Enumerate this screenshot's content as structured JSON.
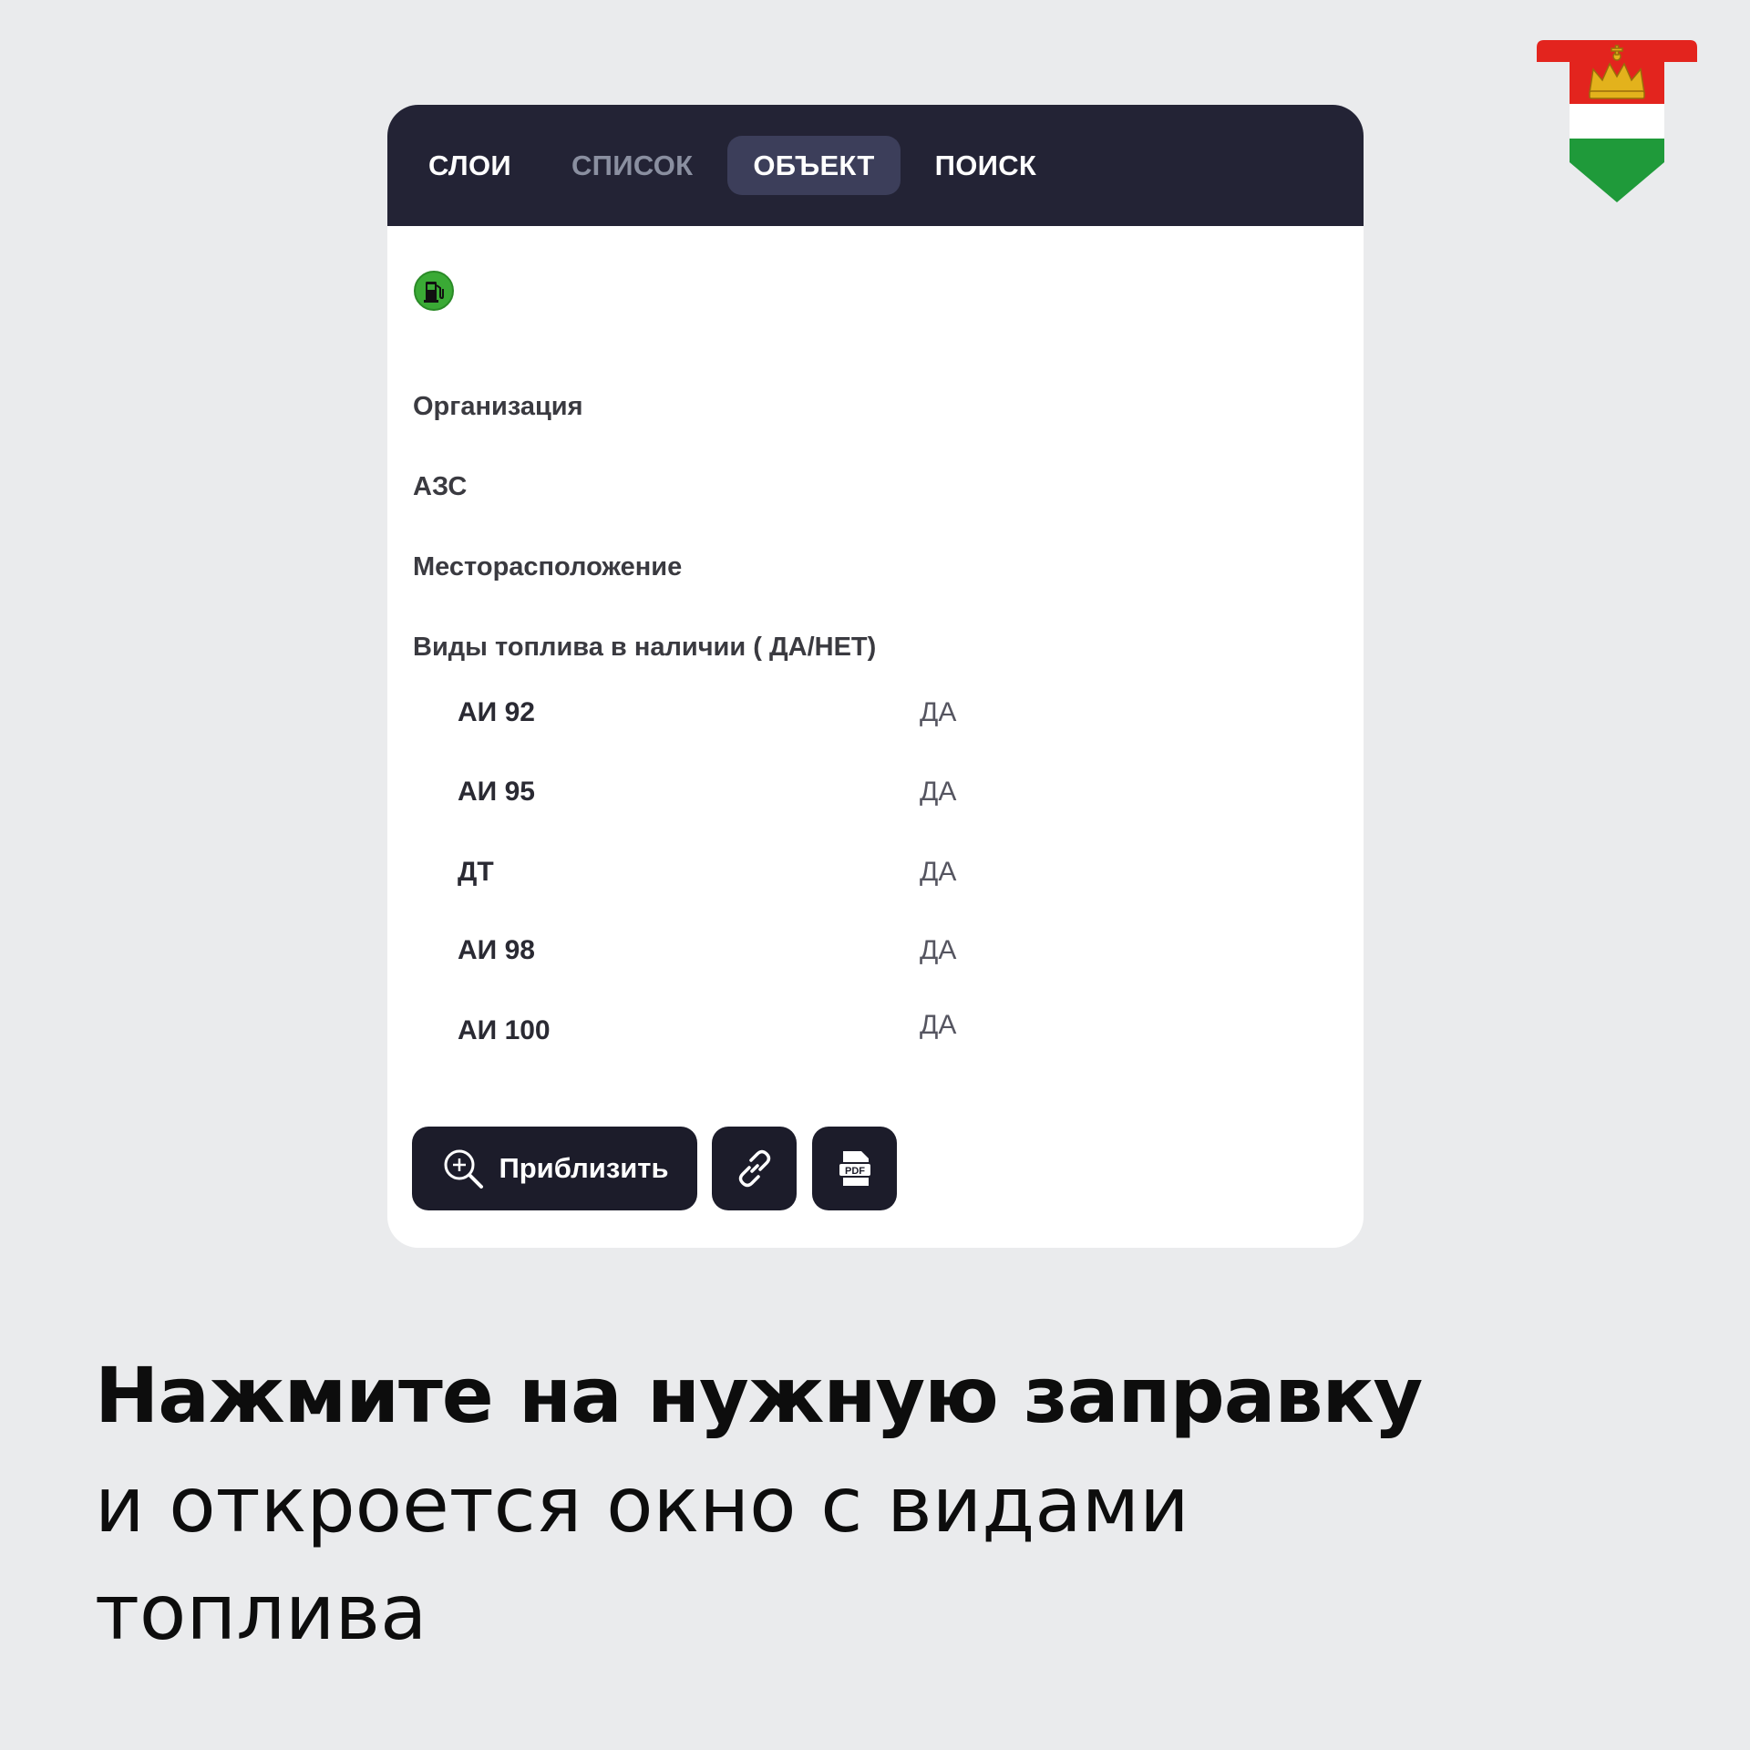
{
  "tabs": [
    {
      "label": "СЛОИ",
      "state": "normal"
    },
    {
      "label": "СПИСОК",
      "state": "dim"
    },
    {
      "label": "ОБЪЕКТ",
      "state": "active"
    },
    {
      "label": "ПОИСК",
      "state": "normal"
    }
  ],
  "object": {
    "icon": "fuel-station-icon",
    "fields": {
      "organization": "Организация",
      "station": "АЗС",
      "location": "Месторасположение",
      "fuel_header": "Виды топлива в наличии ( ДА/НЕТ)"
    },
    "fuels": [
      {
        "label": "АИ 92",
        "value": "ДА"
      },
      {
        "label": "АИ 95",
        "value": "ДА"
      },
      {
        "label": "ДТ",
        "value": "ДА"
      },
      {
        "label": "АИ 98",
        "value": "ДА"
      },
      {
        "label": "АИ 100",
        "value": "ДА"
      }
    ]
  },
  "actions": {
    "zoom_label": "Приблизить",
    "link_icon": "link-icon",
    "pdf_icon_text": "PDF"
  },
  "caption": {
    "headline": "Нажмите на нужную заправку",
    "line2": "и откроется окно с видами",
    "line3": "топлива"
  },
  "colors": {
    "header_bg": "#232335",
    "active_tab_bg": "#3c3e5a",
    "button_bg": "#1c1c2a",
    "fuel_icon": "#3aaa35"
  }
}
